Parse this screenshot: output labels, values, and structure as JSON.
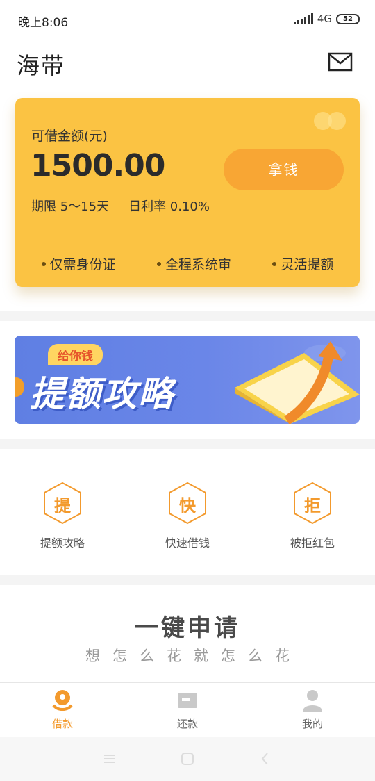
{
  "status_bar": {
    "time": "晚上8:06",
    "network": "4G",
    "battery": "52"
  },
  "header": {
    "title": "海带",
    "mail_icon": "mail-icon"
  },
  "loan_card": {
    "amount_label": "可借金额(元)",
    "amount": "1500.00",
    "take_button": "拿钱",
    "term": "期限 5～15天",
    "daily_rate": "日利率 0.10%",
    "features": [
      "仅需身份证",
      "全程系统审",
      "灵活提额"
    ]
  },
  "banner": {
    "tag": "给你钱",
    "title": "提额攻略"
  },
  "quick_entries": [
    {
      "glyph": "提",
      "label": "提额攻略"
    },
    {
      "glyph": "快",
      "label": "快速借钱"
    },
    {
      "glyph": "拒",
      "label": "被拒红包"
    }
  ],
  "apply": {
    "title": "一键申请",
    "subtitle": "想怎么花就怎么花"
  },
  "tabbar": {
    "active": "借款",
    "tabs": [
      {
        "label": "借款",
        "icon": "loan-icon"
      },
      {
        "label": "还款",
        "icon": "repay-icon"
      },
      {
        "label": "我的",
        "icon": "profile-icon"
      }
    ]
  },
  "colors": {
    "accent": "#f39a2d",
    "card": "#fbc343",
    "banner": "#6a86e8"
  }
}
